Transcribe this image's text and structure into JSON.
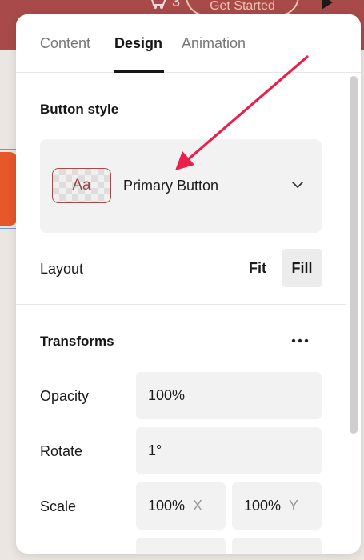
{
  "background": {
    "cart_count": "3",
    "cta_label": "Get Started",
    "brand_color": "#a84a4a"
  },
  "tabs": [
    {
      "label": "Content",
      "active": false
    },
    {
      "label": "Design",
      "active": true
    },
    {
      "label": "Animation",
      "active": false
    }
  ],
  "button_style": {
    "title": "Button style",
    "swatch_text": "Aa",
    "selected": "Primary Button"
  },
  "layout": {
    "label": "Layout",
    "options": [
      "Fit",
      "Fill"
    ],
    "selected": "Fill"
  },
  "transforms": {
    "title": "Transforms",
    "opacity": {
      "label": "Opacity",
      "value": "100%"
    },
    "rotate": {
      "label": "Rotate",
      "value": "1°"
    },
    "scale": {
      "label": "Scale",
      "x_value": "100%",
      "x_axis": "X",
      "y_value": "100%",
      "y_axis": "Y"
    }
  },
  "icons": [
    "cart-icon",
    "play-icon",
    "chevron-down-icon",
    "more-horizontal-icon",
    "annotation-arrow"
  ],
  "colors": {
    "annotation": "#e8204a",
    "accent_swatch": "#9a4242"
  }
}
